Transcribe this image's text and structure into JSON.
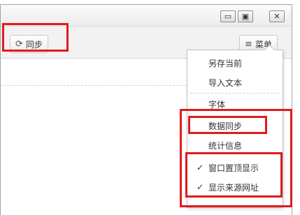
{
  "window": {
    "controls": {
      "minimize": "▭",
      "restore": "▣",
      "close": "✕"
    }
  },
  "toolbar": {
    "sync_label": "同步",
    "sync_icon": "refresh-icon",
    "menu_label": "菜单",
    "menu_icon": "hamburger-icon"
  },
  "menu": {
    "items": [
      {
        "label": "另存当前",
        "checked": false
      },
      {
        "label": "导入文本",
        "checked": false
      },
      {
        "label": "字体",
        "checked": false
      },
      {
        "label": "数据同步",
        "checked": false
      },
      {
        "label": "统计信息",
        "checked": false
      },
      {
        "label": "窗口置顶显示",
        "checked": true
      },
      {
        "label": "显示来源网址",
        "checked": true
      }
    ],
    "check_mark": "✓"
  },
  "colors": {
    "highlight": "#e01b1b"
  }
}
